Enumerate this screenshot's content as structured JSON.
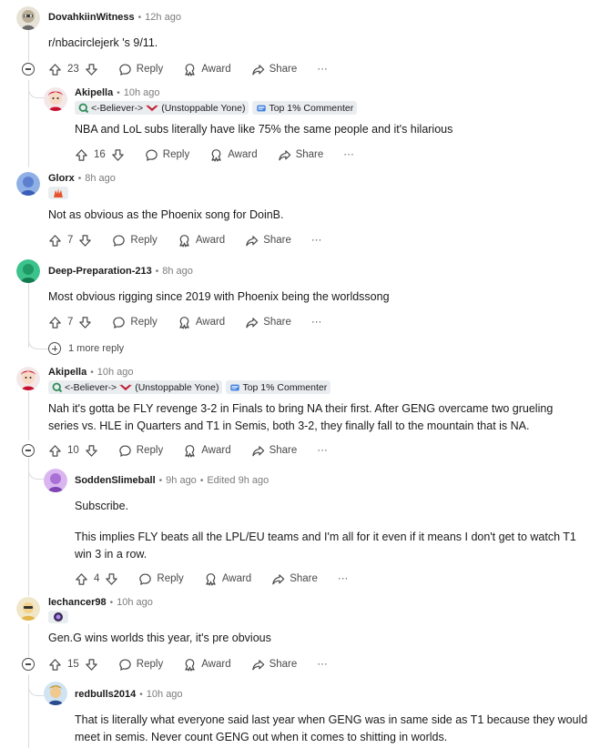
{
  "comments": [
    {
      "username": "DovahkiinWitness",
      "time": "12h ago",
      "text": "r/nbacirclejerk 's 9/11.",
      "votes": "23",
      "reply": "Reply",
      "award": "Award",
      "share": "Share",
      "more": "···"
    },
    {
      "username": "Akipella",
      "time": "10h ago",
      "flair1": "<-Believer->",
      "flair1b": "(Unstoppable Yone)",
      "flair2": "Top 1% Commenter",
      "text": "NBA and LoL subs literally have like 75% the same people and it's hilarious",
      "votes": "16",
      "reply": "Reply",
      "award": "Award",
      "share": "Share",
      "more": "···"
    },
    {
      "username": "Glorx",
      "time": "8h ago",
      "text": "Not as obvious as the Phoenix song for DoinB.",
      "votes": "7",
      "reply": "Reply",
      "award": "Award",
      "share": "Share",
      "more": "···"
    },
    {
      "username": "Deep-Preparation-213",
      "time": "8h ago",
      "text": "Most obvious rigging since 2019 with Phoenix being the worldssong",
      "votes": "7",
      "reply": "Reply",
      "award": "Award",
      "share": "Share",
      "more": "···",
      "more_replies": "1 more reply"
    },
    {
      "username": "Akipella",
      "time": "10h ago",
      "flair1": "<-Believer->",
      "flair1b": "(Unstoppable Yone)",
      "flair2": "Top 1% Commenter",
      "text": "Nah it's gotta be FLY revenge 3-2 in Finals to bring NA their first. After GENG overcame two grueling series vs. HLE in Quarters and T1 in Semis, both 3-2, they finally fall to the mountain that is NA.",
      "votes": "10",
      "reply": "Reply",
      "award": "Award",
      "share": "Share",
      "more": "···"
    },
    {
      "username": "SoddenSlimeball",
      "time": "9h ago",
      "edited": "Edited 9h ago",
      "text": "Subscribe.",
      "text2": "This implies FLY beats all the LPL/EU teams and I'm all for it even if it means I don't get to watch T1 win 3 in a row.",
      "votes": "4",
      "reply": "Reply",
      "award": "Award",
      "share": "Share",
      "more": "···"
    },
    {
      "username": "lechancer98",
      "time": "10h ago",
      "text": "Gen.G wins worlds this year, it's pre obvious",
      "votes": "15",
      "reply": "Reply",
      "award": "Award",
      "share": "Share",
      "more": "···"
    },
    {
      "username": "redbulls2014",
      "time": "10h ago",
      "text": "That is literally what everyone said last year when GENG was in same side as T1 because they would meet in semis. Never count GENG out when it comes to shitting in worlds."
    }
  ],
  "icons": {
    "upvote": "arrow-up-icon",
    "downvote": "arrow-down-icon",
    "reply": "speech-bubble-icon",
    "award": "award-icon",
    "share": "share-arrow-icon",
    "collapse": "minus-circle-icon",
    "expand": "plus-circle-icon"
  },
  "colors": {
    "text": "#1a1a1b",
    "muted": "#7c7c7c",
    "flair_bg": "#eaedef",
    "thread_line": "#d8dcdf"
  }
}
